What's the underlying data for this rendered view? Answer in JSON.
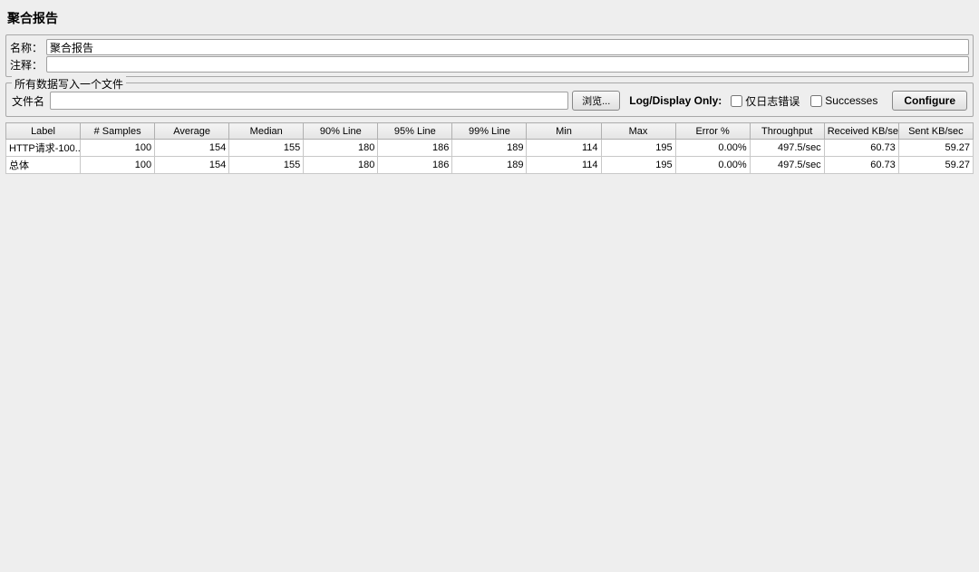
{
  "panel": {
    "title": "聚合报告",
    "name_label": "名称：",
    "name_value": "聚合报告",
    "comment_label": "注释：",
    "comment_value": ""
  },
  "file_group": {
    "legend": "所有数据写入一个文件",
    "filename_label": "文件名",
    "filename_value": "",
    "browse_label": "浏览...",
    "log_display_label": "Log/Display Only:",
    "errors_label": "仅日志错误",
    "successes_label": "Successes",
    "configure_label": "Configure"
  },
  "table": {
    "headers": [
      "Label",
      "# Samples",
      "Average",
      "Median",
      "90% Line",
      "95% Line",
      "99% Line",
      "Min",
      "Max",
      "Error %",
      "Throughput",
      "Received KB/sec",
      "Sent KB/sec"
    ],
    "rows": [
      {
        "label": "HTTP请求-100...",
        "samples": "100",
        "average": "154",
        "median": "155",
        "p90": "180",
        "p95": "186",
        "p99": "189",
        "min": "114",
        "max": "195",
        "error": "0.00%",
        "throughput": "497.5/sec",
        "received": "60.73",
        "sent": "59.27"
      },
      {
        "label": "总体",
        "samples": "100",
        "average": "154",
        "median": "155",
        "p90": "180",
        "p95": "186",
        "p99": "189",
        "min": "114",
        "max": "195",
        "error": "0.00%",
        "throughput": "497.5/sec",
        "received": "60.73",
        "sent": "59.27"
      }
    ]
  }
}
